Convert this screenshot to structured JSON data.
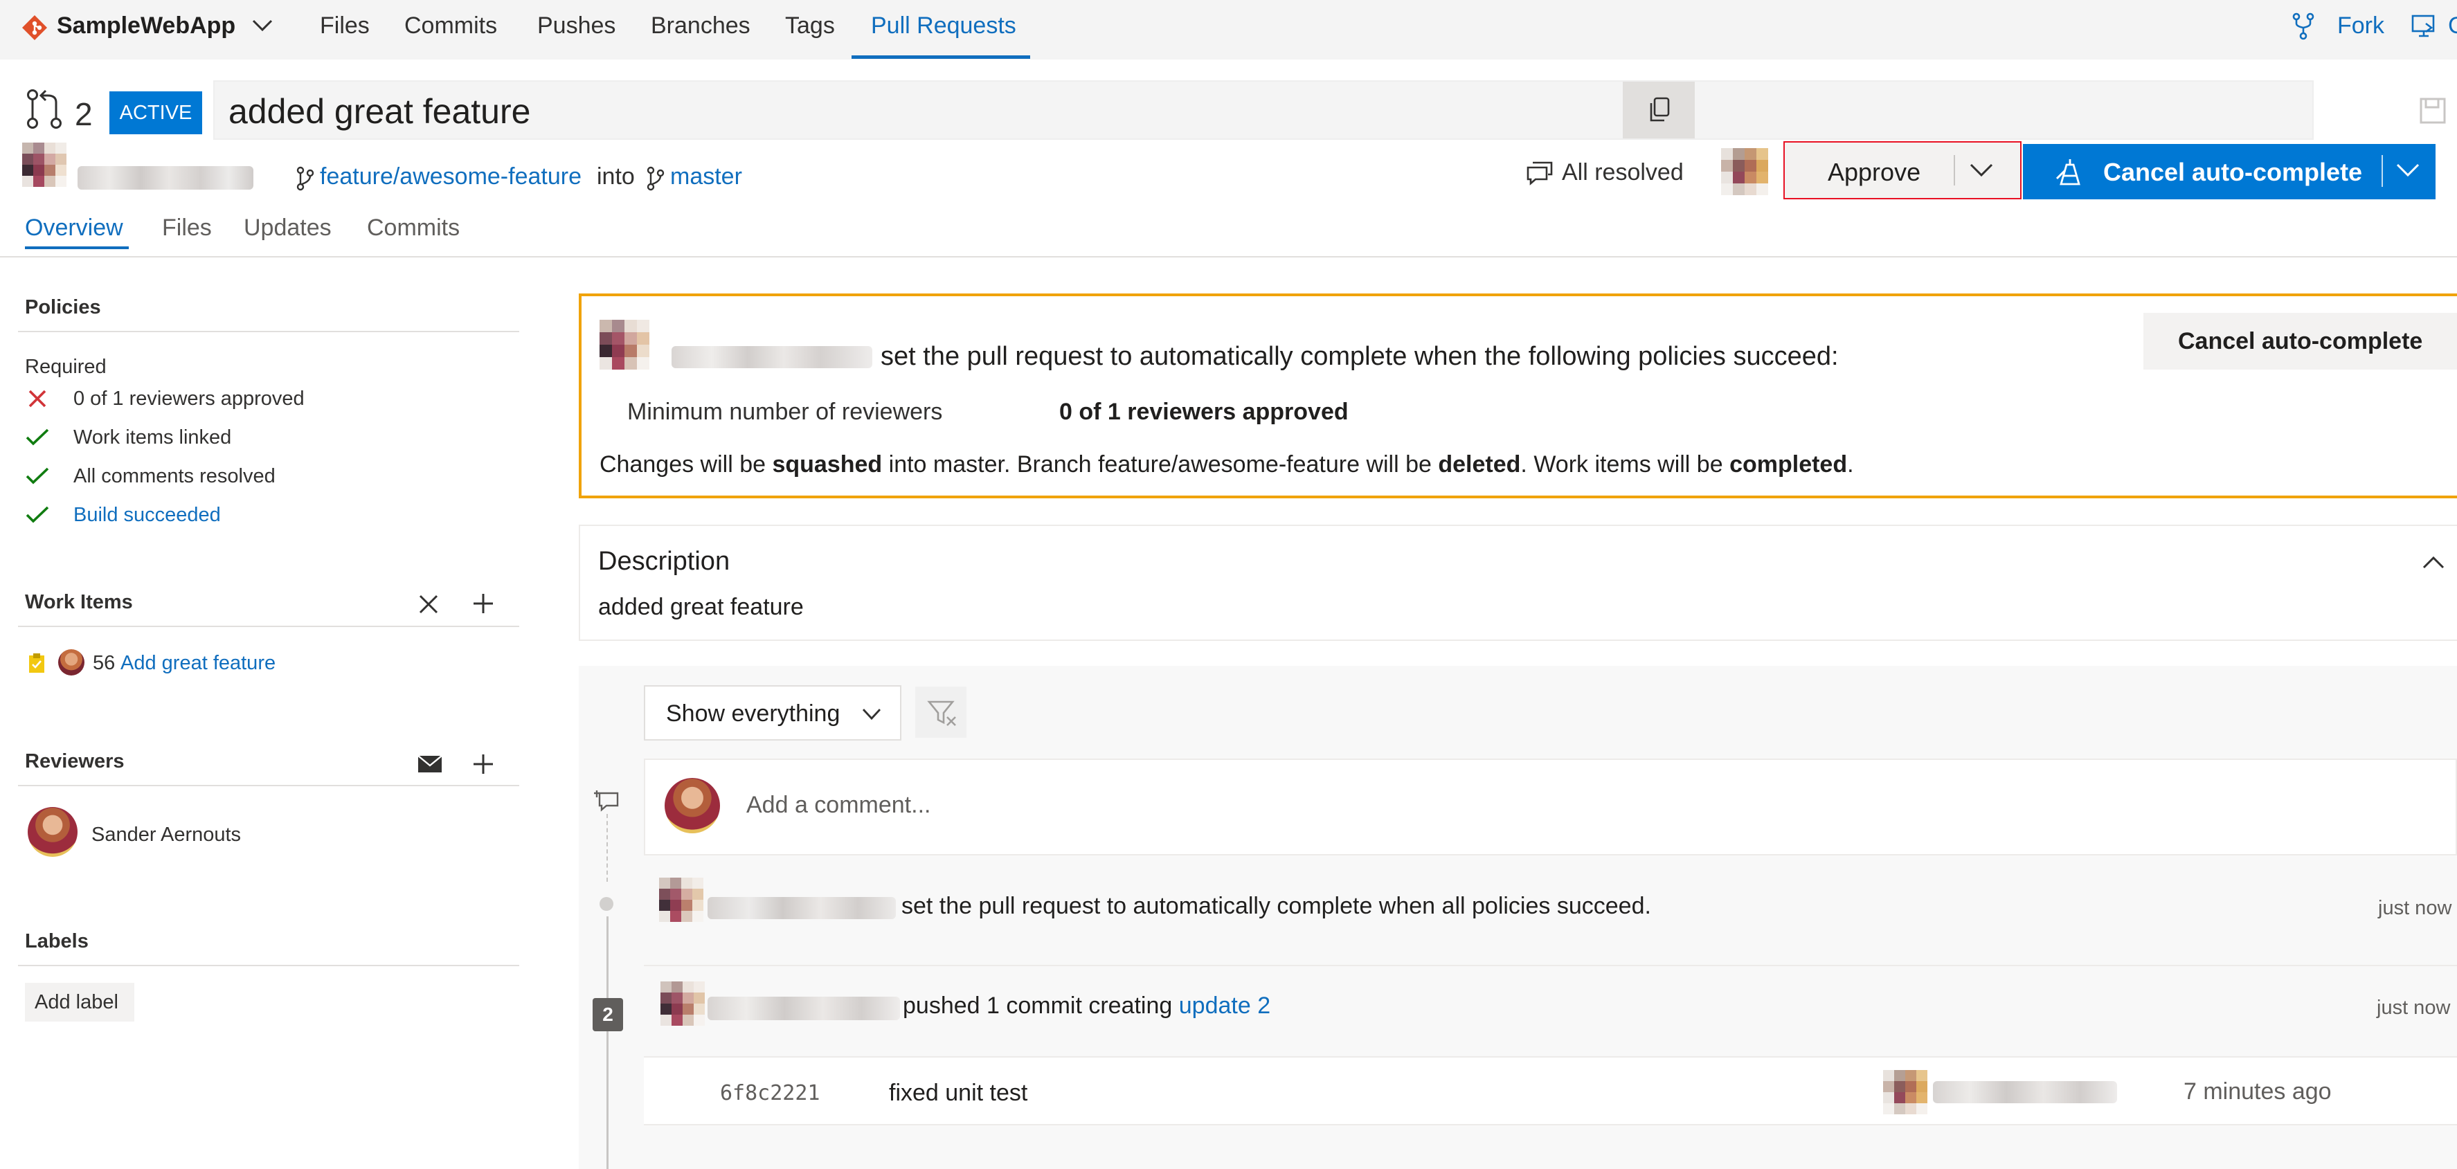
{
  "colors": {
    "accent": "#106ebe",
    "warning_border": "#f0a30a",
    "success": "#107c10",
    "error": "#d13438",
    "primary_button": "#0078d4"
  },
  "topnav": {
    "app_name": "SampleWebApp",
    "tabs": [
      "Files",
      "Commits",
      "Pushes",
      "Branches",
      "Tags",
      "Pull Requests"
    ],
    "active_tab": "Pull Requests",
    "fork_label": "Fork"
  },
  "pr": {
    "id": "2",
    "status_badge": "ACTIVE",
    "title": "added great feature",
    "source_branch": "feature/awesome-feature",
    "into_label": "into",
    "target_branch": "master",
    "comments_status": "All resolved",
    "approve_label": "Approve",
    "cancel_autocomplete_label": "Cancel auto-complete"
  },
  "subtabs": [
    "Overview",
    "Files",
    "Updates",
    "Commits"
  ],
  "sidebar": {
    "policies_heading": "Policies",
    "required_label": "Required",
    "policies": [
      {
        "status": "failed",
        "text": "0 of 1 reviewers approved",
        "is_link": false
      },
      {
        "status": "passed",
        "text": "Work items linked",
        "is_link": false
      },
      {
        "status": "passed",
        "text": "All comments resolved",
        "is_link": false
      },
      {
        "status": "passed",
        "text": "Build succeeded",
        "is_link": true
      }
    ],
    "work_items_heading": "Work Items",
    "work_item": {
      "id": "56",
      "title": "Add great feature"
    },
    "reviewers_heading": "Reviewers",
    "reviewer_name": "Sander Aernouts",
    "labels_heading": "Labels",
    "add_label": "Add label"
  },
  "autocomplete_banner": {
    "message": "set the pull request to automatically complete when the following policies succeed:",
    "policy_name": "Minimum number of reviewers",
    "policy_status": "0 of 1 reviewers approved",
    "cancel_label": "Cancel auto-complete",
    "summary_parts": [
      {
        "text": "Changes will be ",
        "bold": false
      },
      {
        "text": "squashed",
        "bold": true
      },
      {
        "text": " into master. Branch feature/awesome-feature will be ",
        "bold": false
      },
      {
        "text": "deleted",
        "bold": true
      },
      {
        "text": ". Work items will be ",
        "bold": false
      },
      {
        "text": "completed",
        "bold": true
      },
      {
        "text": ".",
        "bold": false
      }
    ]
  },
  "description": {
    "heading": "Description",
    "text": "added great feature"
  },
  "activity": {
    "filter_label": "Show everything",
    "comment_placeholder": "Add a comment...",
    "events": [
      {
        "text": "set the pull request to automatically complete when all policies succeed.",
        "time": "just now"
      },
      {
        "text": "pushed 1 commit creating ",
        "link": "update 2",
        "time": "just now",
        "badge": "2"
      }
    ],
    "commit": {
      "hash": "6f8c2221",
      "message": "fixed unit test",
      "time": "7 minutes ago"
    }
  }
}
